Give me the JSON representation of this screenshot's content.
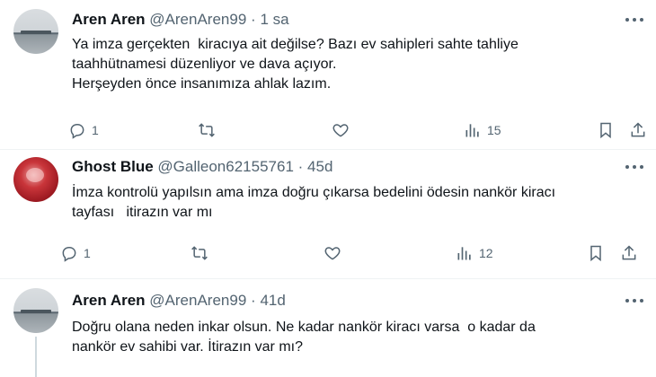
{
  "tweets": [
    {
      "name": "Aren Aren",
      "handle": "@ArenAren99",
      "sep": "·",
      "time": "1 sa",
      "lines": [
        "Ya imza gerçekten  kiracıya ait değilse? Bazı ev sahipleri sahte tahliye",
        "taahhütnamesi düzenliyor ve dava açıyor.",
        "Herşeyden önce insanımıza ahlak lazım."
      ],
      "reply_count": "1",
      "retweet_count": "",
      "like_count": "",
      "view_count": "15",
      "avatar": "sea-ship-avatar"
    },
    {
      "name": "Ghost Blue",
      "handle": "@Galleon62155761",
      "sep": "·",
      "time": "45d",
      "lines": [
        "İmza kontrolü yapılsın ama imza doğru çıkarsa bedelini ödesin nankör kiracı",
        "tayfası   itirazın var mı"
      ],
      "reply_count": "1",
      "retweet_count": "",
      "like_count": "",
      "view_count": "12",
      "avatar": "red-abstract-avatar"
    },
    {
      "name": "Aren Aren",
      "handle": "@ArenAren99",
      "sep": "·",
      "time": "41d",
      "lines": [
        "Doğru olana neden inkar olsun. Ne kadar nankör kiracı varsa  o kadar da",
        "nankör ev sahibi var. İtirazın var mı?"
      ],
      "avatar": "sea-ship-avatar"
    }
  ],
  "icons": {
    "reply": "reply-icon",
    "retweet": "retweet-icon",
    "like": "heart-icon",
    "views": "views-icon",
    "bookmark": "bookmark-icon",
    "share": "share-icon",
    "more": "more-icon"
  },
  "colors": {
    "text": "#0f1419",
    "secondary": "#536471",
    "divider": "#eff3f4",
    "thread_line": "#cfd9de"
  }
}
